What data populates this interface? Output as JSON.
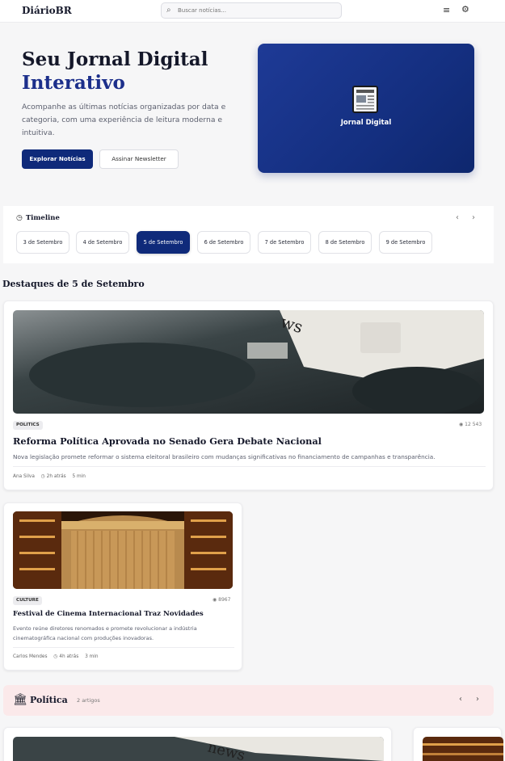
{
  "header": {
    "logo": "DiárioBR",
    "search_placeholder": "Buscar notícias...",
    "menu_icon": "hamburger-icon",
    "settings_icon": "gear-icon"
  },
  "hero": {
    "title_line1": "Seu Jornal Digital",
    "title_line2": "Interativo",
    "description": "Acompanhe as últimas notícias organizadas por data e categoria, com uma experiência de leitura moderna e intuitiva.",
    "primary_button": "Explorar Notícias",
    "secondary_button": "Assinar Newsletter",
    "card_label": "Jornal Digital"
  },
  "timeline": {
    "title": "Timeline",
    "dates": [
      "3 de Setembro",
      "4 de Setembro",
      "5 de Setembro",
      "6 de Setembro",
      "7 de Setembro",
      "8 de Setembro",
      "9 de Setembro"
    ],
    "active": "5 de Setembro"
  },
  "section_title": "Destaques de 5 de Setembro",
  "articles": [
    {
      "category": "POLITICS",
      "views": "12 543",
      "title": "Reforma Política Aprovada no Senado Gera Debate Nacional",
      "summary": "Nova legislação promete reformar o sistema eleitoral brasileiro com mudanças significativas no financiamento de campanhas e transparência.",
      "author": "Ana Silva",
      "time": "2h atrás",
      "read": "5 min"
    },
    {
      "category": "CULTURE",
      "views": "8967",
      "title": "Festival de Cinema Internacional Traz Novidades",
      "summary": "Evento reúne diretores renomados e promete revolucionar a indústria cinematográfica nacional com produções inovadoras.",
      "author": "Carlos Mendes",
      "time": "4h atrás",
      "read": "3 min"
    }
  ],
  "category_band": {
    "title": "Política",
    "count": "2 artigos"
  },
  "colors": {
    "brand": "#0f2a7a",
    "accent_text": "#1c2f8b",
    "band": "#fbe9ea"
  }
}
